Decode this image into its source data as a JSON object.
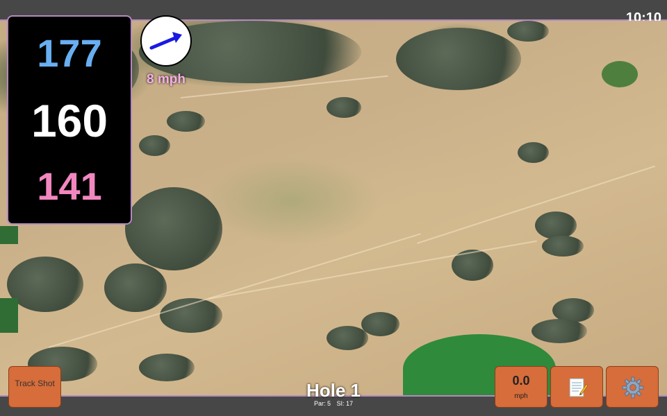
{
  "status": {
    "time": "10:10"
  },
  "distances": {
    "back": "177",
    "middle": "160",
    "front": "141"
  },
  "wind": {
    "speed": "8 mph",
    "direction_icon": "arrow-icon",
    "arrow_color": "#1a1ae0"
  },
  "actions": {
    "track_shot_label": "Track Shot",
    "speed_value": "0.0",
    "speed_unit": "mph",
    "notes_icon": "notepad-icon",
    "settings_icon": "gear-icon"
  },
  "hole": {
    "title": "Hole 1",
    "par": "Par: 5",
    "si": "SI: 17"
  },
  "colors": {
    "back": "#68aef0",
    "middle": "#ffffff",
    "front": "#f287c0",
    "button": "#d66d3a",
    "accent": "#b58ac0"
  }
}
